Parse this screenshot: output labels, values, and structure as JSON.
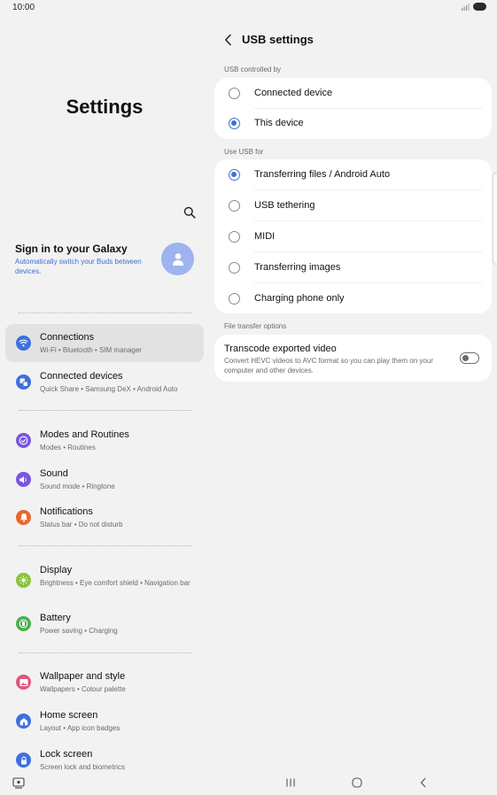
{
  "status_bar": {
    "time": "10:00"
  },
  "left_panel": {
    "title": "Settings",
    "account": {
      "title": "Sign in to your Galaxy",
      "subtitle": "Automatically switch your Buds between devices."
    },
    "items": [
      {
        "title": "Connections",
        "subtitle": "Wi-Fi  •  Bluetooth  •  SIM manager",
        "icon": "wifi-icon",
        "color": "#3e6fe0"
      },
      {
        "title": "Connected devices",
        "subtitle": "Quick Share  •  Samsung DeX  •  Android Auto",
        "icon": "connected-devices-icon",
        "color": "#3e6fe0"
      },
      {
        "title": "Modes and Routines",
        "subtitle": "Modes  •  Routines",
        "icon": "check-circle-icon",
        "color": "#7a55e0"
      },
      {
        "title": "Sound",
        "subtitle": "Sound mode  •  Ringtone",
        "icon": "volume-icon",
        "color": "#7a55e0"
      },
      {
        "title": "Notifications",
        "subtitle": "Status bar  •  Do not disturb",
        "icon": "bell-icon",
        "color": "#e8672e"
      },
      {
        "title": "Display",
        "subtitle": "Brightness  •  Eye comfort shield  •  Navigation bar",
        "icon": "sun-icon",
        "color": "#8bc43a"
      },
      {
        "title": "Battery",
        "subtitle": "Power saving  •  Charging",
        "icon": "battery-icon",
        "color": "#4caf50"
      },
      {
        "title": "Wallpaper and style",
        "subtitle": "Wallpapers  •  Colour palette",
        "icon": "image-icon",
        "color": "#e0577b"
      },
      {
        "title": "Home screen",
        "subtitle": "Layout  •  App icon badges",
        "icon": "home-icon",
        "color": "#3e6fe0"
      },
      {
        "title": "Lock screen",
        "subtitle": "Screen lock and biometrics",
        "icon": "lock-icon",
        "color": "#3e6fe0"
      }
    ]
  },
  "usb_settings": {
    "title": "USB settings",
    "controlled_by": {
      "label": "USB controlled by",
      "options": [
        "Connected device",
        "This device"
      ],
      "selected": "This device"
    },
    "use_for": {
      "label": "Use USB for",
      "options": [
        "Transferring files / Android Auto",
        "USB tethering",
        "MIDI",
        "Transferring images",
        "Charging phone only"
      ],
      "selected": "Transferring files / Android Auto"
    },
    "file_transfer": {
      "label": "File transfer options",
      "toggle_title": "Transcode exported video",
      "toggle_subtitle": "Convert HEVC videos to AVC format so you can play them on your computer and other devices.",
      "enabled": false
    }
  },
  "colors": {
    "accent": "#3e6fd6",
    "background": "#f2f2f2",
    "card": "#ffffff"
  }
}
